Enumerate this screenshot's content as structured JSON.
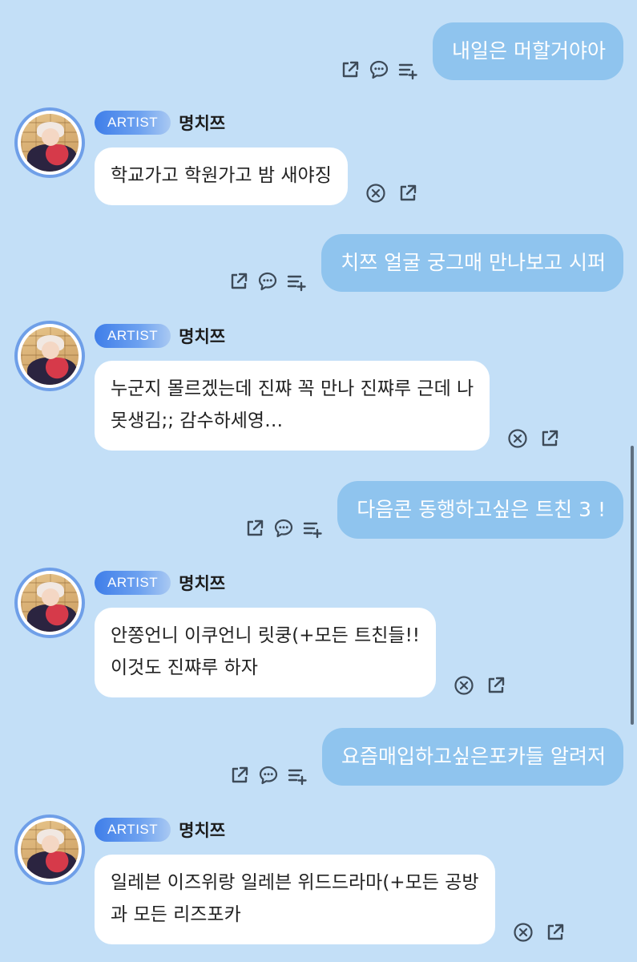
{
  "colors": {
    "background": "#c3dff7",
    "outgoing_bubble": "#8fc4ee",
    "incoming_bubble": "#ffffff",
    "badge": "#3f7ee9",
    "avatar_ring": "#6f9fe8"
  },
  "sender": {
    "badge": "ARTIST",
    "name": "명치쯔"
  },
  "messages": [
    {
      "direction": "out",
      "text": "내일은 머할거야아",
      "icons": [
        "share-icon",
        "reply-bubble-icon",
        "add-to-list-icon"
      ]
    },
    {
      "direction": "in",
      "text": "학교가고 학원가고 밤 새야징",
      "icons": [
        "close-circle-icon",
        "share-icon"
      ]
    },
    {
      "direction": "out",
      "text": "치쯔 얼굴 궁그매 만나보고 시퍼",
      "icons": [
        "share-icon",
        "reply-bubble-icon",
        "add-to-list-icon"
      ]
    },
    {
      "direction": "in",
      "text": "누군지 몰르겠는데 진쨔 꼭 만나 진쨔루 근데 나\n못생김;; 감수하세영…",
      "icons": [
        "close-circle-icon",
        "share-icon"
      ]
    },
    {
      "direction": "out",
      "text": "다음콘 동행하고싶은 트친 3 !",
      "icons": [
        "share-icon",
        "reply-bubble-icon",
        "add-to-list-icon"
      ]
    },
    {
      "direction": "in",
      "text": "안쫑언니 이쿠언니 릿쿵(+모든 트친들!!\n이것도 진쨔루 하자",
      "icons": [
        "close-circle-icon",
        "share-icon"
      ]
    },
    {
      "direction": "out",
      "text": "요즘매입하고싶은포카들 알려저",
      "icons": [
        "share-icon",
        "reply-bubble-icon",
        "add-to-list-icon"
      ]
    },
    {
      "direction": "in",
      "text": "일레븐 이즈위랑 일레븐 위드드라마(+모든 공방\n과 모든 리즈포카",
      "icons": [
        "close-circle-icon",
        "share-icon"
      ]
    }
  ]
}
